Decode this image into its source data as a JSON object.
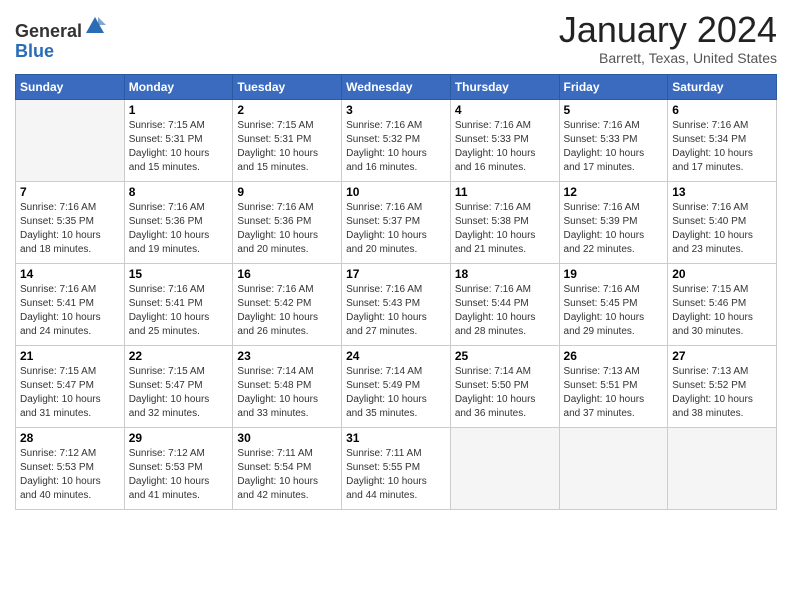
{
  "logo": {
    "general": "General",
    "blue": "Blue"
  },
  "header": {
    "month": "January 2024",
    "location": "Barrett, Texas, United States"
  },
  "weekdays": [
    "Sunday",
    "Monday",
    "Tuesday",
    "Wednesday",
    "Thursday",
    "Friday",
    "Saturday"
  ],
  "weeks": [
    [
      {
        "day": "",
        "sunrise": "",
        "sunset": "",
        "daylight": ""
      },
      {
        "day": "1",
        "sunrise": "Sunrise: 7:15 AM",
        "sunset": "Sunset: 5:31 PM",
        "daylight": "Daylight: 10 hours and 15 minutes."
      },
      {
        "day": "2",
        "sunrise": "Sunrise: 7:15 AM",
        "sunset": "Sunset: 5:31 PM",
        "daylight": "Daylight: 10 hours and 15 minutes."
      },
      {
        "day": "3",
        "sunrise": "Sunrise: 7:16 AM",
        "sunset": "Sunset: 5:32 PM",
        "daylight": "Daylight: 10 hours and 16 minutes."
      },
      {
        "day": "4",
        "sunrise": "Sunrise: 7:16 AM",
        "sunset": "Sunset: 5:33 PM",
        "daylight": "Daylight: 10 hours and 16 minutes."
      },
      {
        "day": "5",
        "sunrise": "Sunrise: 7:16 AM",
        "sunset": "Sunset: 5:33 PM",
        "daylight": "Daylight: 10 hours and 17 minutes."
      },
      {
        "day": "6",
        "sunrise": "Sunrise: 7:16 AM",
        "sunset": "Sunset: 5:34 PM",
        "daylight": "Daylight: 10 hours and 17 minutes."
      }
    ],
    [
      {
        "day": "7",
        "sunrise": "Sunrise: 7:16 AM",
        "sunset": "Sunset: 5:35 PM",
        "daylight": "Daylight: 10 hours and 18 minutes."
      },
      {
        "day": "8",
        "sunrise": "Sunrise: 7:16 AM",
        "sunset": "Sunset: 5:36 PM",
        "daylight": "Daylight: 10 hours and 19 minutes."
      },
      {
        "day": "9",
        "sunrise": "Sunrise: 7:16 AM",
        "sunset": "Sunset: 5:36 PM",
        "daylight": "Daylight: 10 hours and 20 minutes."
      },
      {
        "day": "10",
        "sunrise": "Sunrise: 7:16 AM",
        "sunset": "Sunset: 5:37 PM",
        "daylight": "Daylight: 10 hours and 20 minutes."
      },
      {
        "day": "11",
        "sunrise": "Sunrise: 7:16 AM",
        "sunset": "Sunset: 5:38 PM",
        "daylight": "Daylight: 10 hours and 21 minutes."
      },
      {
        "day": "12",
        "sunrise": "Sunrise: 7:16 AM",
        "sunset": "Sunset: 5:39 PM",
        "daylight": "Daylight: 10 hours and 22 minutes."
      },
      {
        "day": "13",
        "sunrise": "Sunrise: 7:16 AM",
        "sunset": "Sunset: 5:40 PM",
        "daylight": "Daylight: 10 hours and 23 minutes."
      }
    ],
    [
      {
        "day": "14",
        "sunrise": "Sunrise: 7:16 AM",
        "sunset": "Sunset: 5:41 PM",
        "daylight": "Daylight: 10 hours and 24 minutes."
      },
      {
        "day": "15",
        "sunrise": "Sunrise: 7:16 AM",
        "sunset": "Sunset: 5:41 PM",
        "daylight": "Daylight: 10 hours and 25 minutes."
      },
      {
        "day": "16",
        "sunrise": "Sunrise: 7:16 AM",
        "sunset": "Sunset: 5:42 PM",
        "daylight": "Daylight: 10 hours and 26 minutes."
      },
      {
        "day": "17",
        "sunrise": "Sunrise: 7:16 AM",
        "sunset": "Sunset: 5:43 PM",
        "daylight": "Daylight: 10 hours and 27 minutes."
      },
      {
        "day": "18",
        "sunrise": "Sunrise: 7:16 AM",
        "sunset": "Sunset: 5:44 PM",
        "daylight": "Daylight: 10 hours and 28 minutes."
      },
      {
        "day": "19",
        "sunrise": "Sunrise: 7:16 AM",
        "sunset": "Sunset: 5:45 PM",
        "daylight": "Daylight: 10 hours and 29 minutes."
      },
      {
        "day": "20",
        "sunrise": "Sunrise: 7:15 AM",
        "sunset": "Sunset: 5:46 PM",
        "daylight": "Daylight: 10 hours and 30 minutes."
      }
    ],
    [
      {
        "day": "21",
        "sunrise": "Sunrise: 7:15 AM",
        "sunset": "Sunset: 5:47 PM",
        "daylight": "Daylight: 10 hours and 31 minutes."
      },
      {
        "day": "22",
        "sunrise": "Sunrise: 7:15 AM",
        "sunset": "Sunset: 5:47 PM",
        "daylight": "Daylight: 10 hours and 32 minutes."
      },
      {
        "day": "23",
        "sunrise": "Sunrise: 7:14 AM",
        "sunset": "Sunset: 5:48 PM",
        "daylight": "Daylight: 10 hours and 33 minutes."
      },
      {
        "day": "24",
        "sunrise": "Sunrise: 7:14 AM",
        "sunset": "Sunset: 5:49 PM",
        "daylight": "Daylight: 10 hours and 35 minutes."
      },
      {
        "day": "25",
        "sunrise": "Sunrise: 7:14 AM",
        "sunset": "Sunset: 5:50 PM",
        "daylight": "Daylight: 10 hours and 36 minutes."
      },
      {
        "day": "26",
        "sunrise": "Sunrise: 7:13 AM",
        "sunset": "Sunset: 5:51 PM",
        "daylight": "Daylight: 10 hours and 37 minutes."
      },
      {
        "day": "27",
        "sunrise": "Sunrise: 7:13 AM",
        "sunset": "Sunset: 5:52 PM",
        "daylight": "Daylight: 10 hours and 38 minutes."
      }
    ],
    [
      {
        "day": "28",
        "sunrise": "Sunrise: 7:12 AM",
        "sunset": "Sunset: 5:53 PM",
        "daylight": "Daylight: 10 hours and 40 minutes."
      },
      {
        "day": "29",
        "sunrise": "Sunrise: 7:12 AM",
        "sunset": "Sunset: 5:53 PM",
        "daylight": "Daylight: 10 hours and 41 minutes."
      },
      {
        "day": "30",
        "sunrise": "Sunrise: 7:11 AM",
        "sunset": "Sunset: 5:54 PM",
        "daylight": "Daylight: 10 hours and 42 minutes."
      },
      {
        "day": "31",
        "sunrise": "Sunrise: 7:11 AM",
        "sunset": "Sunset: 5:55 PM",
        "daylight": "Daylight: 10 hours and 44 minutes."
      },
      {
        "day": "",
        "sunrise": "",
        "sunset": "",
        "daylight": ""
      },
      {
        "day": "",
        "sunrise": "",
        "sunset": "",
        "daylight": ""
      },
      {
        "day": "",
        "sunrise": "",
        "sunset": "",
        "daylight": ""
      }
    ]
  ]
}
